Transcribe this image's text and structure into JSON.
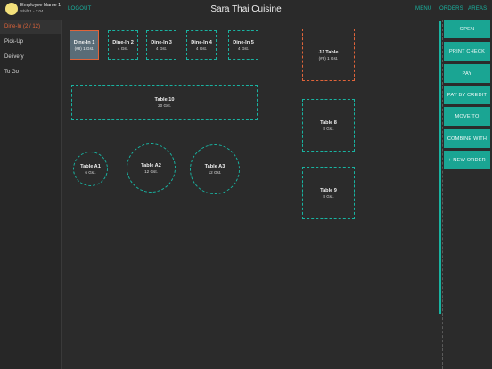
{
  "header": {
    "employee_name": "Employee Name 1",
    "shift": "Shift 1 - 2:04",
    "logout_label": "LOGOUT",
    "app_title": "Sara Thai Cuisine",
    "nav": [
      "MENU",
      "ORDERS",
      "AREAS"
    ]
  },
  "sidebar": {
    "items": [
      {
        "label": "Dine-In (2 / 12)",
        "active": true
      },
      {
        "label": "Pick-Up",
        "active": false
      },
      {
        "label": "Delivery",
        "active": false
      },
      {
        "label": "To Go",
        "active": false
      }
    ]
  },
  "tables": {
    "dine_in_1": {
      "name": "Dine-In 1",
      "guests": "(#8) 1 Gst."
    },
    "dine_in_2": {
      "name": "Dine-In 2",
      "guests": "4 Gst."
    },
    "dine_in_3": {
      "name": "Dine-In 3",
      "guests": "4 Gst."
    },
    "dine_in_4": {
      "name": "Dine-In 4",
      "guests": "4 Gst."
    },
    "dine_in_5": {
      "name": "Dine-In 5",
      "guests": "4 Gst."
    },
    "jj_table": {
      "name": "JJ Table",
      "guests": "(#9) 1 Gst."
    },
    "table_10": {
      "name": "Table 10",
      "guests": "20 Gst."
    },
    "table_8": {
      "name": "Table 8",
      "guests": "8 Gst."
    },
    "table_a1": {
      "name": "Table A1",
      "guests": "6 Gst."
    },
    "table_a2": {
      "name": "Table A2",
      "guests": "12 Gst."
    },
    "table_a3": {
      "name": "Table A3",
      "guests": "12 Gst."
    },
    "table_9": {
      "name": "Table 9",
      "guests": "8 Gst."
    }
  },
  "actions": {
    "open": "OPEN",
    "print_check": "PRINT CHECK",
    "pay": "PAY",
    "pay_by_credit": "PAY BY CREDIT",
    "move_to": "MOVE TO",
    "combine_with": "COMBINE WITH",
    "new_order": "+ NEW ORDER"
  },
  "colors": {
    "accent": "#19b3a1",
    "active": "#e0643a",
    "selected_fill": "#5a6c77",
    "background": "#2b2b2b"
  }
}
